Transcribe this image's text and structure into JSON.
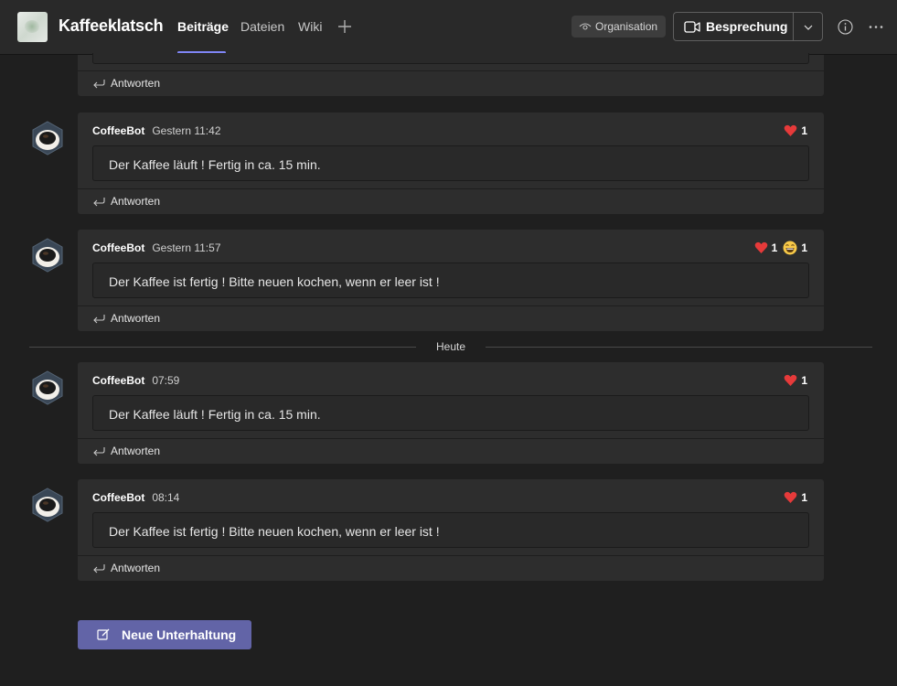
{
  "header": {
    "team_name": "Kaffeeklatsch",
    "tabs": [
      {
        "label": "Beiträge",
        "active": true
      },
      {
        "label": "Dateien",
        "active": false
      },
      {
        "label": "Wiki",
        "active": false
      }
    ],
    "add_tab_icon": "plus-icon",
    "org_badge": "Organisation",
    "meet_button": "Besprechung",
    "accent_color": "#7f85f5"
  },
  "partial_post": {
    "reply_label": "Antworten"
  },
  "posts": [
    {
      "author": "CoffeeBot",
      "time": "Gestern 11:42",
      "message": "Der Kaffee läuft ! Fertig in ca. 15 min.",
      "reactions": [
        {
          "icon": "heart-icon",
          "count": "1"
        }
      ],
      "reply_label": "Antworten"
    },
    {
      "author": "CoffeeBot",
      "time": "Gestern 11:57",
      "message": "Der Kaffee ist fertig ! Bitte neuen kochen, wenn er leer ist !",
      "reactions": [
        {
          "icon": "heart-icon",
          "count": "1"
        },
        {
          "icon": "laugh-emoji-icon",
          "count": "1"
        }
      ],
      "reply_label": "Antworten"
    },
    {
      "author": "CoffeeBot",
      "time": "07:59",
      "message": "Der Kaffee läuft ! Fertig in ca. 15 min.",
      "reactions": [
        {
          "icon": "heart-icon",
          "count": "1"
        }
      ],
      "reply_label": "Antworten"
    },
    {
      "author": "CoffeeBot",
      "time": "08:14",
      "message": "Der Kaffee ist fertig ! Bitte neuen kochen, wenn er leer ist !",
      "reactions": [
        {
          "icon": "heart-icon",
          "count": "1"
        }
      ],
      "reply_label": "Antworten"
    }
  ],
  "day_divider": "Heute",
  "new_conversation_label": "Neue Unterhaltung"
}
